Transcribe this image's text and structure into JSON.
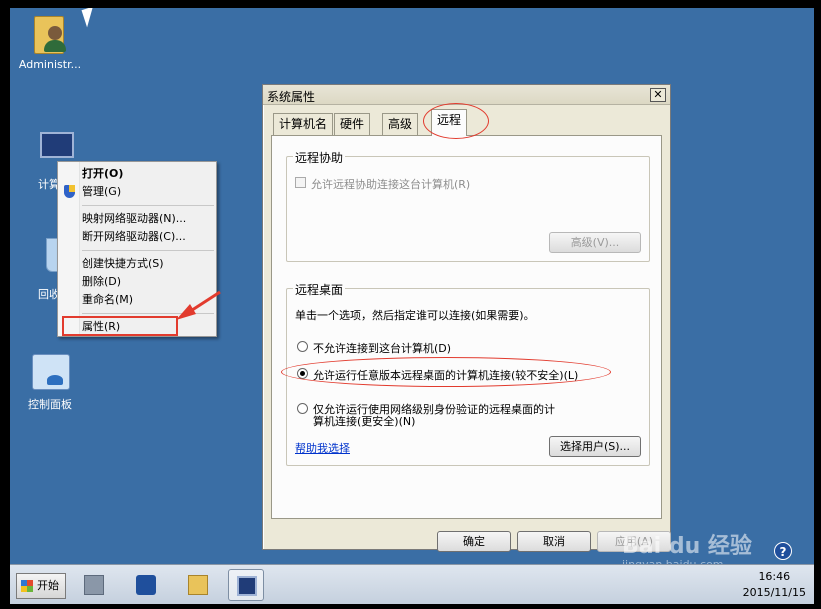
{
  "desktop": {
    "icons": [
      {
        "label": "Administr..."
      },
      {
        "label": "计算"
      },
      {
        "label": "回收"
      },
      {
        "label": "控制面板"
      }
    ]
  },
  "context_menu": {
    "items": [
      {
        "label": "打开(O)"
      },
      {
        "label": "管理(G)"
      },
      {
        "label": "映射网络驱动器(N)..."
      },
      {
        "label": "断开网络驱动器(C)..."
      },
      {
        "label": "创建快捷方式(S)"
      },
      {
        "label": "删除(D)"
      },
      {
        "label": "重命名(M)"
      },
      {
        "label": "属性(R)"
      }
    ]
  },
  "dialog": {
    "title": "系统属性",
    "close_glyph": "✕",
    "tabs": [
      {
        "label": "计算机名"
      },
      {
        "label": "硬件"
      },
      {
        "label": "高级"
      },
      {
        "label": "远程"
      }
    ],
    "remote_assistance": {
      "group_label": "远程协助",
      "checkbox_label": "允许远程协助连接这台计算机(R)",
      "advanced_button": "高级(V)..."
    },
    "remote_desktop": {
      "group_label": "远程桌面",
      "instruction": "单击一个选项，然后指定谁可以连接(如果需要)。",
      "options": [
        {
          "label": "不允许连接到这台计算机(D)",
          "selected": false
        },
        {
          "label": "允许运行任意版本远程桌面的计算机连接(较不安全)(L)",
          "selected": true
        },
        {
          "label_line1": "仅允许运行使用网络级别身份验证的远程桌面的计",
          "label_line2": "算机连接(更安全)(N)",
          "selected": false
        }
      ],
      "help_link": "帮助我选择",
      "select_users_button": "选择用户(S)..."
    },
    "buttons": {
      "ok": "确定",
      "cancel": "取消",
      "apply": "应用(A)"
    }
  },
  "taskbar": {
    "start_label": "开始",
    "clock_time": "16:46",
    "clock_date": "2015/11/15",
    "help_glyph": "?"
  },
  "watermark": {
    "brand": "Bai du 经验",
    "url": "jingyan.baidu.com"
  },
  "colors": {
    "desktop": "#3a6ea5",
    "annotation": "#e23b2e"
  }
}
